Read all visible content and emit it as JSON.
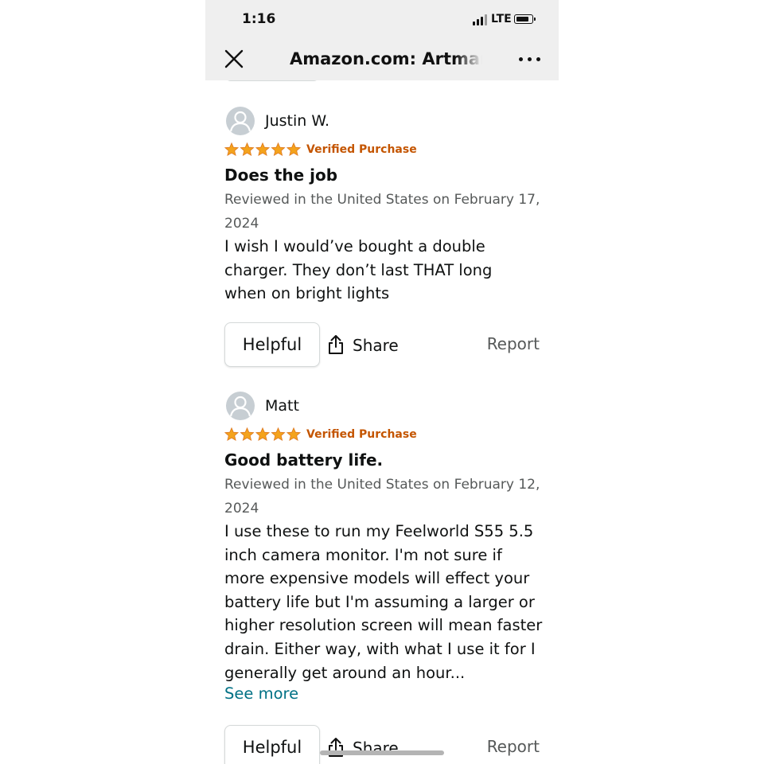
{
  "status_bar": {
    "time": "1:16",
    "network": "LTE"
  },
  "browser": {
    "page_title": "Amazon.com: Artman"
  },
  "reviews": [
    {
      "reviewer": "Justin W.",
      "rating": 5,
      "verified": "Verified Purchase",
      "title": "Does the job",
      "date": "Reviewed in the United States on February 17, 2024",
      "body": "I wish I would’ve bought a double charger. They don’t last THAT long when on bright lights",
      "helpful_label": "Helpful",
      "share_label": "Share",
      "report_label": "Report"
    },
    {
      "reviewer": "Matt",
      "rating": 5,
      "verified": "Verified Purchase",
      "title": "Good battery life.",
      "date": "Reviewed in the United States on February 12, 2024",
      "body": "I use these to run my Feelworld S55 5.5 inch camera monitor. I'm not sure if more expensive models will effect your battery life but I'm assuming a larger or higher resolution screen will mean faster drain. Either way, with what I use it for I generally get around an hour...",
      "see_more": "See more",
      "helpful_label": "Helpful",
      "share_label": "Share",
      "report_label": "Report"
    }
  ],
  "colors": {
    "star": "#f4a31c",
    "verified": "#c45500",
    "link": "#007185",
    "muted_text": "#565959",
    "top_bar": "#efefef"
  },
  "icons": [
    "signal-icon",
    "battery-icon",
    "close-icon",
    "more-icon",
    "user-icon",
    "star-icon",
    "share-icon"
  ]
}
